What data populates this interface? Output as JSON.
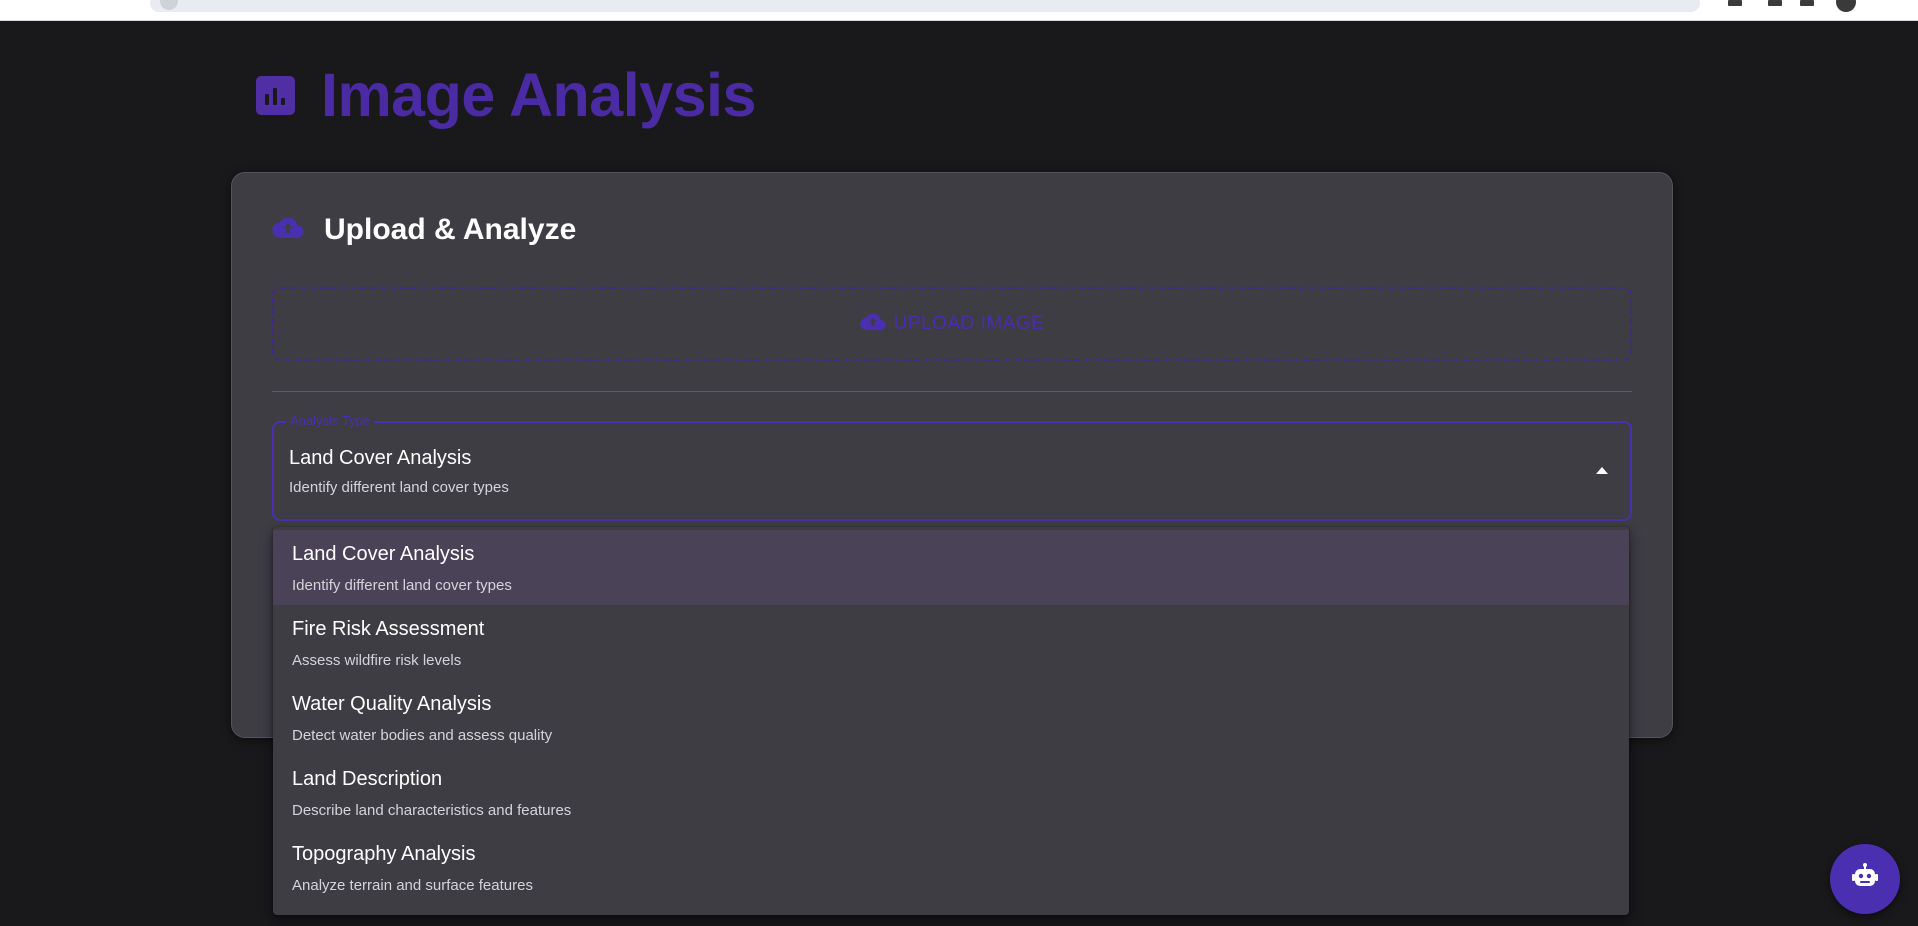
{
  "page": {
    "title": "Image Analysis",
    "title_icon": "bar-chart-icon"
  },
  "upload_card": {
    "title": "Upload & Analyze",
    "title_icon": "cloud-upload-icon",
    "upload_button_label": "UPLOAD IMAGE",
    "upload_button_icon": "cloud-upload-icon"
  },
  "analysis_select": {
    "legend": "Analysis Type",
    "value": "Land Cover Analysis",
    "value_description": "Identify different land cover types",
    "expanded": true
  },
  "menu": {
    "items": [
      {
        "label": "Land Cover Analysis",
        "description": "Identify different land cover types",
        "selected": true
      },
      {
        "label": "Fire Risk Assessment",
        "description": "Assess wildfire risk levels",
        "selected": false
      },
      {
        "label": "Water Quality Analysis",
        "description": "Detect water bodies and assess quality",
        "selected": false
      },
      {
        "label": "Land Description",
        "description": "Describe land characteristics and features",
        "selected": false
      },
      {
        "label": "Topography Analysis",
        "description": "Analyze terrain and surface features",
        "selected": false
      }
    ]
  },
  "chat_fab": {
    "icon": "robot-icon"
  },
  "colors": {
    "accent": "#4a2fb0",
    "background": "#19191b",
    "card": "#3e3d44",
    "selected_item": "#4a4358"
  }
}
